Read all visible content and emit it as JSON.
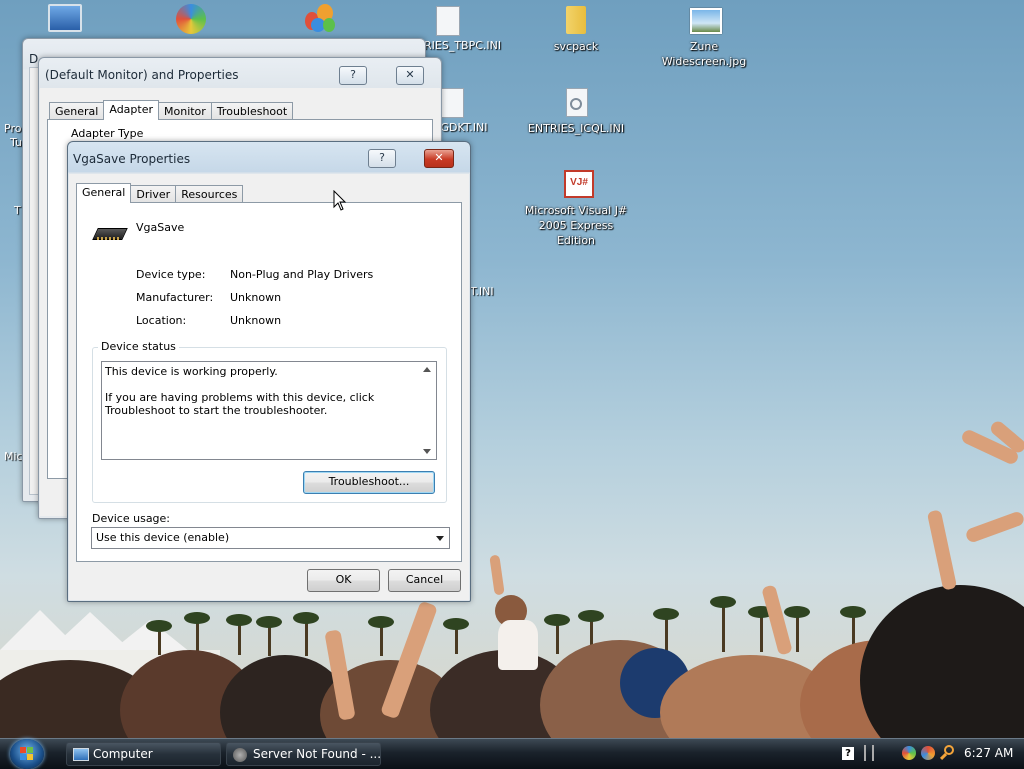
{
  "desktop": {
    "icons": [
      {
        "label": "svcpack"
      },
      {
        "label": "Zune Widescreen.jpg"
      },
      {
        "label": "ENTRIES_ICQL.INI"
      },
      {
        "label": "Microsoft Visual J#\n2005 Express Edition"
      }
    ],
    "partial_labels": {
      "tbpc": "RIES_TBPC.INI",
      "gdkt": "S_GDKT.INI",
      "tini": "T.INI",
      "pro": "Pro",
      "tu": "Tu",
      "t": "T",
      "mic": "Mic",
      "d": "D"
    }
  },
  "monitor_window": {
    "title": "(Default Monitor) and  Properties",
    "tabs": [
      "General",
      "Adapter",
      "Monitor",
      "Troubleshoot"
    ],
    "active_tab": "Adapter",
    "group_label": "Adapter Type"
  },
  "dialog": {
    "title": "VgaSave Properties",
    "tabs": [
      "General",
      "Driver",
      "Resources"
    ],
    "active_tab": "General",
    "device_name": "VgaSave",
    "props": [
      {
        "label": "Device type:",
        "value": "Non-Plug and Play Drivers"
      },
      {
        "label": "Manufacturer:",
        "value": "Unknown"
      },
      {
        "label": "Location:",
        "value": "Unknown"
      }
    ],
    "status_group": "Device status",
    "status_line1": "This device is working properly.",
    "status_line2": "If you are having problems with this device, click Troubleshoot to start the troubleshooter.",
    "troubleshoot_button": "Troubleshoot...",
    "usage_label": "Device usage:",
    "usage_value": "Use this device (enable)",
    "ok_button": "OK",
    "cancel_button": "Cancel",
    "help_glyph": "?",
    "close_glyph": "✕"
  },
  "taskbar": {
    "items": [
      {
        "label": "Computer"
      },
      {
        "label": "Server Not Found - ..."
      }
    ],
    "clock": "6:27 AM"
  },
  "colors": {
    "close_red": "#c83a24",
    "taskbar": "#1a222b",
    "title_text": "#1c2a38"
  }
}
